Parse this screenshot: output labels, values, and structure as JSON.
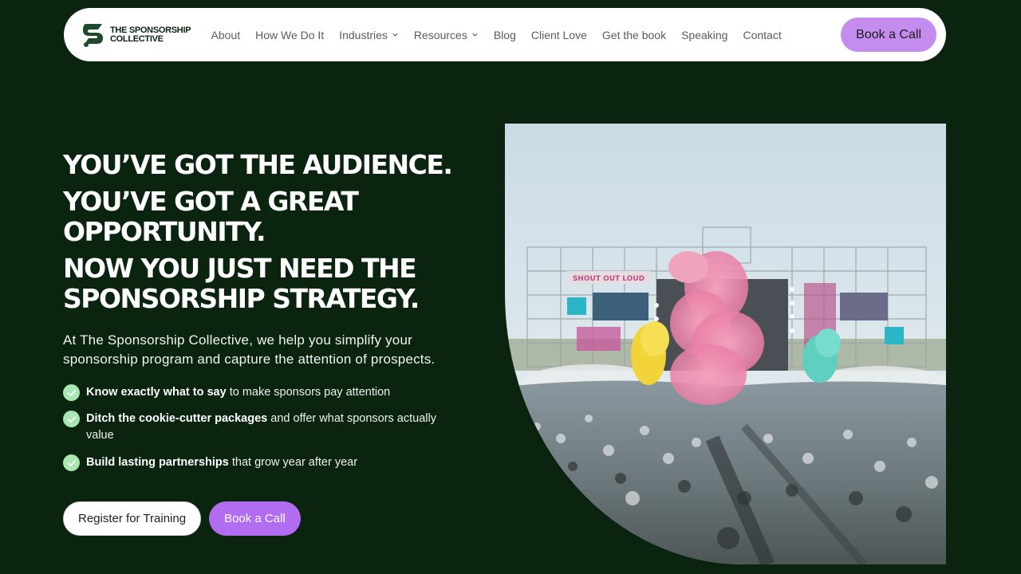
{
  "nav": {
    "logo_line1": "The Sponsorship",
    "logo_line2": "Collective",
    "items": [
      {
        "label": "About",
        "dropdown": false
      },
      {
        "label": "How We Do It",
        "dropdown": false
      },
      {
        "label": "Industries",
        "dropdown": true
      },
      {
        "label": "Resources",
        "dropdown": true
      },
      {
        "label": "Blog",
        "dropdown": false
      },
      {
        "label": "Client Love",
        "dropdown": false
      },
      {
        "label": "Get the book",
        "dropdown": false
      },
      {
        "label": "Speaking",
        "dropdown": false
      },
      {
        "label": "Contact",
        "dropdown": false
      }
    ],
    "cta": "Book a Call"
  },
  "hero": {
    "headline": [
      "You’ve got the audience.",
      "You’ve got a great opportunity.",
      "Now you just need the sponsorship strategy."
    ],
    "intro": "At The Sponsorship Collective, we help you simplify your sponsorship program and capture the attention of prospects.",
    "checks": [
      {
        "bold": "Know exactly what to say",
        "rest": " to make sponsors pay attention"
      },
      {
        "bold": "Ditch the cookie-cutter packages",
        "rest": " and offer what sponsors actually value"
      },
      {
        "bold": "Build lasting partnerships",
        "rest": " that grow year after year"
      }
    ],
    "buttons": {
      "register": "Register for Training",
      "book": "Book a Call"
    },
    "image_stage_sign": "SHOUT OUT LOUD"
  },
  "colors": {
    "background": "#0a2410",
    "cta_purple": "#c58cf0",
    "cta_purple_dark": "#b26cf0",
    "check_green": "#a9e6b1"
  },
  "icons": {
    "logo": "sponsorship-collective-logo",
    "dropdown": "chevron-down-icon",
    "check": "check-circle-icon"
  }
}
